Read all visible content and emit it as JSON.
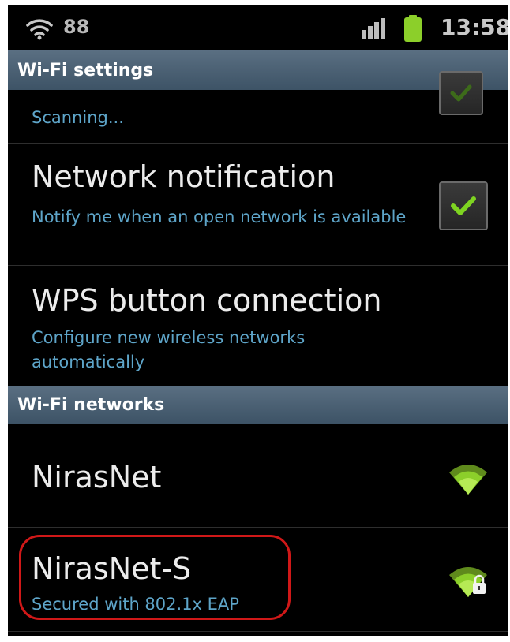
{
  "status_bar": {
    "wifi_number": "88",
    "time": "13:58",
    "icons": [
      "wifi-icon",
      "signal-bars-icon",
      "battery-icon"
    ]
  },
  "wifi_settings_header": "Wi-Fi settings",
  "scanning": {
    "status_text": "Scanning...",
    "checkbox_icon": "checkbox-icon"
  },
  "network_notification": {
    "title": "Network notification",
    "description": "Notify me when an open network is available",
    "checked": true
  },
  "wps": {
    "title": "WPS button connection",
    "description": "Configure new wireless networks automatically"
  },
  "wifi_networks_header": "Wi-Fi networks",
  "networks": [
    {
      "name": "NirasNet",
      "subtitle": "",
      "icon": "wifi-signal-icon"
    },
    {
      "name": "NirasNet-S",
      "subtitle": "Secured with 802.1x EAP",
      "icon": "wifi-signal-lock-icon"
    }
  ],
  "colors": {
    "header_bg": "#4a6174",
    "subtitle": "#5ea5c9",
    "check_green": "#7ed321",
    "wifi_green": "#8ccf2a",
    "highlight": "#d01818"
  }
}
